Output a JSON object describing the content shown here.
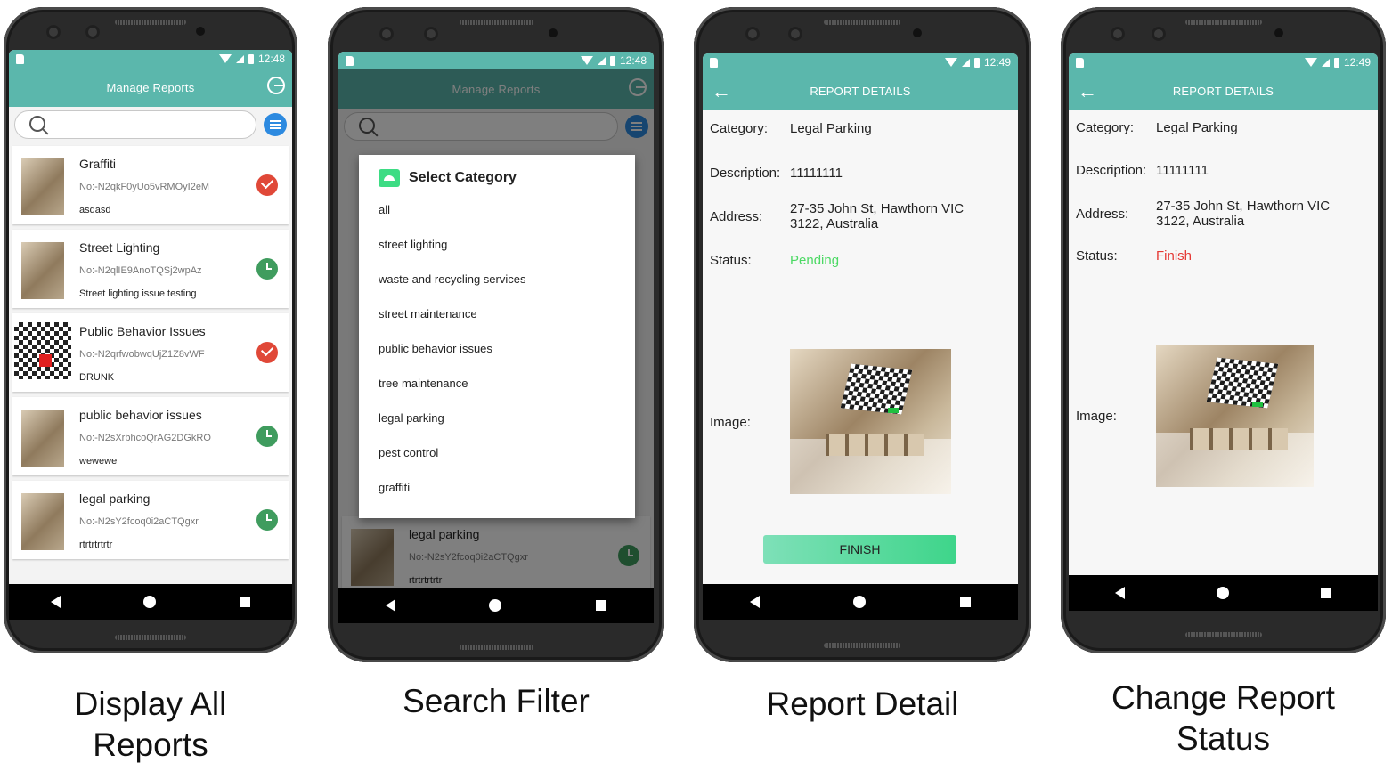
{
  "captions": {
    "p1_line1": "Display All",
    "p1_line2": "Reports",
    "p2": "Search Filter",
    "p3": "Report Detail",
    "p4_line1": "Change Report",
    "p4_line2": "Status"
  },
  "phone1": {
    "time": "12:48",
    "title": "Manage Reports",
    "reports": [
      {
        "title": "Graffiti",
        "no": "No:-N2qkF0yUo5vRMOyI2eM",
        "desc": "asdasd",
        "status": "done"
      },
      {
        "title": "Street Lighting",
        "no": "No:-N2qlIE9AnoTQSj2wpAz",
        "desc": "Street lighting issue testing",
        "status": "pending"
      },
      {
        "title": "Public Behavior Issues",
        "no": "No:-N2qrfwobwqUjZ1Z8vWF",
        "desc": "DRUNK",
        "status": "done"
      },
      {
        "title": "public behavior issues",
        "no": "No:-N2sXrbhcoQrAG2DGkRO",
        "desc": "wewewe",
        "status": "pending"
      },
      {
        "title": "legal parking",
        "no": "No:-N2sY2fcoq0i2aCTQgxr",
        "desc": "rtrtrtrtrtr",
        "status": "pending"
      }
    ]
  },
  "phone2": {
    "time": "12:48",
    "title": "Manage Reports",
    "dialog_title": "Select Category",
    "categories": [
      "all",
      "street lighting",
      "waste and recycling services",
      "street maintenance",
      "public behavior issues",
      "tree maintenance",
      "legal parking",
      "pest control",
      "graffiti"
    ],
    "bg_card": {
      "title": "legal parking",
      "no": "No:-N2sY2fcoq0i2aCTQgxr",
      "desc": "rtrtrtrtrtr"
    }
  },
  "phone3": {
    "time": "12:49",
    "title": "REPORT DETAILS",
    "labels": {
      "category": "Category:",
      "description": "Description:",
      "address": "Address:",
      "status": "Status:",
      "image": "Image:"
    },
    "category": "Legal Parking",
    "description": "11111111",
    "address_line1": "27-35 John St, Hawthorn VIC",
    "address_line2": "3122, Australia",
    "status": "Pending",
    "status_color": "#4cd964",
    "button": "FINISH"
  },
  "phone4": {
    "time": "12:49",
    "title": "REPORT DETAILS",
    "labels": {
      "category": "Category:",
      "description": "Description:",
      "address": "Address:",
      "status": "Status:",
      "image": "Image:"
    },
    "category": "Legal Parking",
    "description": "11111111",
    "address_line1": "27-35 John St, Hawthorn VIC",
    "address_line2": "3122, Australia",
    "status": "Finish",
    "status_color": "#e53935"
  }
}
